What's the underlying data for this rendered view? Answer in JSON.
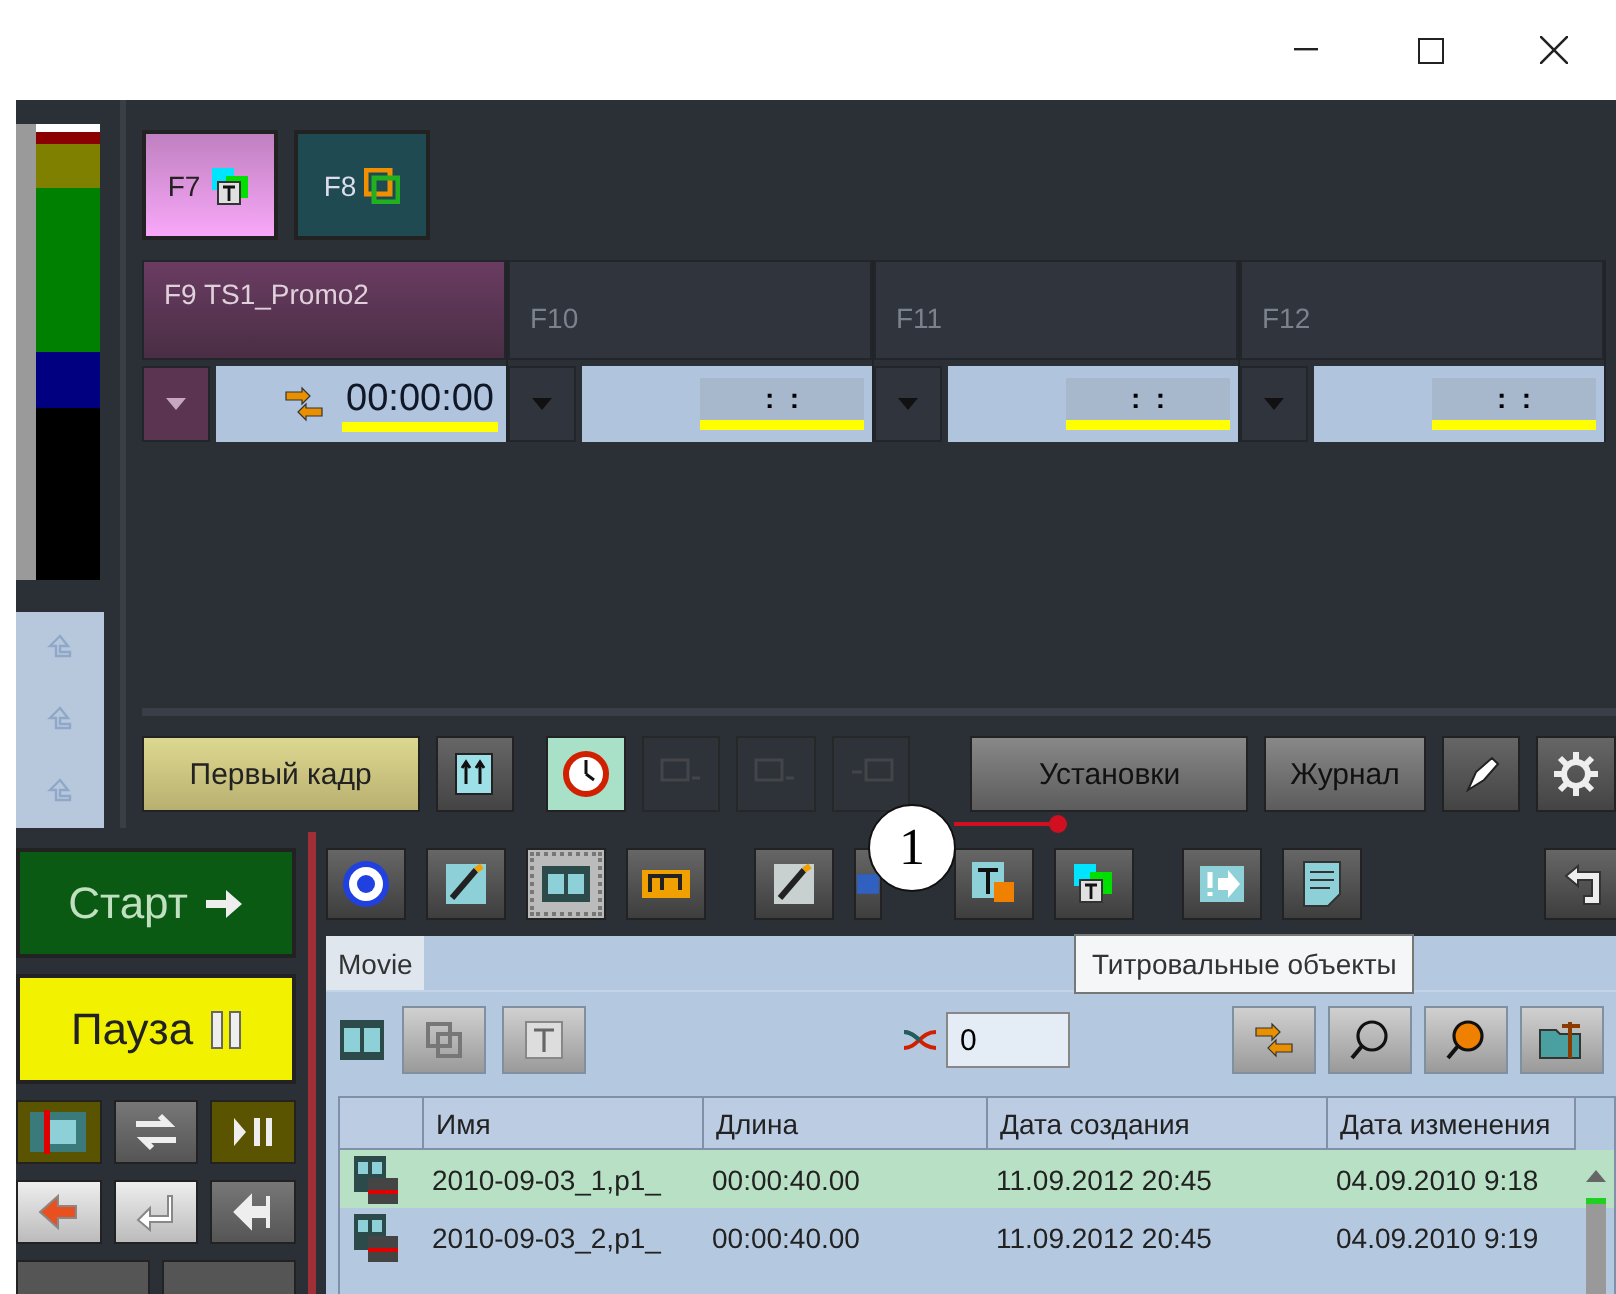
{
  "hotkeys": [
    {
      "label": "F7",
      "selected": true
    },
    {
      "label": "F8",
      "selected": false
    }
  ],
  "channels": [
    {
      "label": "F9 TS1_Promo2",
      "selected": true,
      "synced": true,
      "timecode": "00:00:00"
    },
    {
      "label": "F10",
      "selected": false,
      "synced": false,
      "timecode": ":  :"
    },
    {
      "label": "F11",
      "selected": false,
      "synced": false,
      "timecode": ":  :"
    },
    {
      "label": "F12",
      "selected": false,
      "synced": false,
      "timecode": ":  :"
    }
  ],
  "first_frame_button": "Первый кадр",
  "icon_buttons": [
    {
      "disabled": false
    },
    {
      "disabled": false
    },
    {
      "disabled": true
    },
    {
      "disabled": true
    },
    {
      "disabled": true
    }
  ],
  "settings_button": "Установки",
  "log_button": "Журнал",
  "start_button": "Старт",
  "pause_button": "Пауза",
  "media_tools": [
    {
      "selected": false
    },
    {
      "selected": false
    },
    {
      "selected": true
    },
    {
      "selected": false
    },
    {
      "selected": false
    },
    {
      "selected": false
    },
    {
      "selected": false
    },
    {
      "selected": false
    },
    {
      "selected": false
    },
    {
      "selected": false
    },
    {
      "selected": false
    }
  ],
  "callout": "1",
  "tooltip": "Титровальные объекты",
  "panel": {
    "tab": "Movie",
    "counter": "0",
    "table": {
      "columns": [
        "Имя",
        "Длина",
        "Дата создания",
        "Дата изменения"
      ],
      "rows": [
        {
          "selected": true,
          "cells": [
            "2010-09-03_1,p1_",
            "00:00:40.00",
            "11.09.2012 20:45",
            "04.09.2010 9:18"
          ]
        },
        {
          "selected": false,
          "cells": [
            "2010-09-03_2,p1_",
            "00:00:40.00",
            "11.09.2012 20:45",
            "04.09.2010 9:19"
          ]
        }
      ]
    }
  }
}
